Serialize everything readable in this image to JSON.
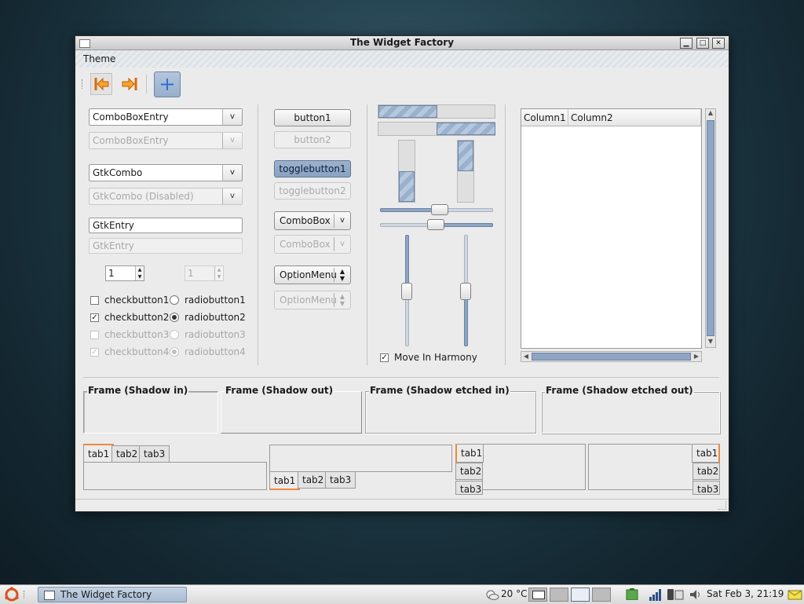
{
  "window": {
    "title": "The Widget Factory"
  },
  "menu": {
    "theme": "Theme"
  },
  "toolbar": {
    "back_icon": "arrow-left-icon",
    "forward_icon": "arrow-right-icon",
    "add_icon": "plus-icon"
  },
  "left": {
    "combo_entry": "ComboBoxEntry",
    "combo_entry_disabled": "ComboBoxEntry",
    "gtk_combo": "GtkCombo",
    "gtk_combo_disabled": "GtkCombo (Disabled)",
    "entry": "GtkEntry",
    "entry_disabled": "GtkEntry",
    "spin": "1",
    "spin_disabled": "1",
    "checks": [
      {
        "label": "checkbutton1",
        "checked": false,
        "disabled": false
      },
      {
        "label": "checkbutton2",
        "checked": true,
        "disabled": false
      },
      {
        "label": "checkbutton3",
        "checked": false,
        "disabled": true
      },
      {
        "label": "checkbutton4",
        "checked": true,
        "disabled": true
      }
    ],
    "radios": [
      {
        "label": "radiobutton1",
        "selected": false,
        "disabled": false
      },
      {
        "label": "radiobutton2",
        "selected": true,
        "disabled": false
      },
      {
        "label": "radiobutton3",
        "selected": false,
        "disabled": true
      },
      {
        "label": "radiobutton4",
        "selected": true,
        "disabled": true
      }
    ]
  },
  "middle": {
    "button1": "button1",
    "button2": "button2",
    "toggle1": "togglebutton1",
    "toggle2": "togglebutton2",
    "combobox": "ComboBox",
    "combobox_disabled": "ComboBox",
    "optionmenu": "OptionMenu",
    "optionmenu_disabled": "OptionMenu"
  },
  "ranges": {
    "progress_h1": 0.5,
    "progress_h2": 0.5,
    "progress_v1": 0.5,
    "progress_v2": 0.5,
    "move_in_harmony": "Move In Harmony",
    "move_in_harmony_checked": true
  },
  "tree": {
    "columns": [
      "Column1",
      "Column2"
    ]
  },
  "frames": [
    "Frame (Shadow in)",
    "Frame (Shadow out)",
    "Frame (Shadow etched in)",
    "Frame (Shadow etched out)"
  ],
  "notebooks": {
    "tabs": [
      "tab1",
      "tab2",
      "tab3"
    ]
  },
  "panel": {
    "task": "The Widget Factory",
    "weather": "20 °C",
    "clock": "Sat Feb  3, 21:19"
  },
  "colors": {
    "accent": "#f0883a",
    "selection": "#8ea5c3"
  }
}
